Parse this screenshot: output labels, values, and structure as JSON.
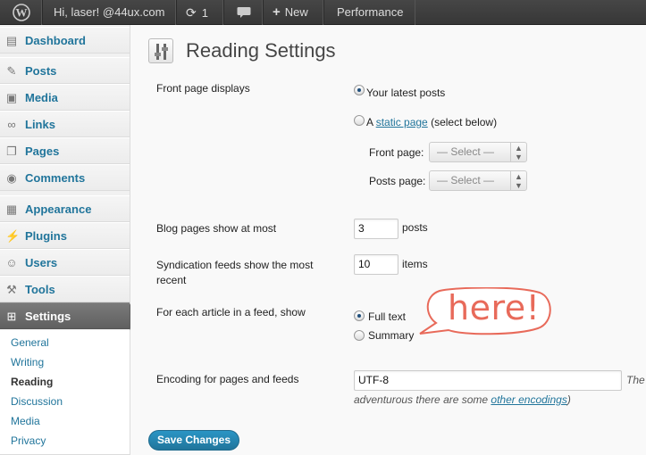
{
  "adminbar": {
    "wp_logo": "wordpress-icon",
    "howdy": "Hi, laser! @44ux.com",
    "updates_count": "1",
    "new_label": "New",
    "performance_label": "Performance"
  },
  "sidebar": {
    "items": [
      {
        "label": "Dashboard",
        "icon": "dashboard-icon"
      },
      {
        "label": "Posts",
        "icon": "pin-icon"
      },
      {
        "label": "Media",
        "icon": "media-icon"
      },
      {
        "label": "Links",
        "icon": "link-icon"
      },
      {
        "label": "Pages",
        "icon": "pages-icon"
      },
      {
        "label": "Comments",
        "icon": "comment-icon"
      },
      {
        "label": "Appearance",
        "icon": "appearance-icon"
      },
      {
        "label": "Plugins",
        "icon": "plugin-icon"
      },
      {
        "label": "Users",
        "icon": "users-icon"
      },
      {
        "label": "Tools",
        "icon": "tools-icon"
      },
      {
        "label": "Settings",
        "icon": "settings-icon"
      }
    ],
    "submenu": [
      "General",
      "Writing",
      "Reading",
      "Discussion",
      "Media",
      "Privacy"
    ]
  },
  "main": {
    "title": "Reading Settings",
    "front_page_displays_label": "Front page displays",
    "option_latest": "Your latest posts",
    "option_static_prefix": "A ",
    "option_static_link": "static page",
    "option_static_suffix": " (select below)",
    "front_page_label": "Front page:",
    "posts_page_label": "Posts page:",
    "select_placeholder": "— Select —",
    "blog_pages_label": "Blog pages show at most",
    "blog_pages_value": "3",
    "blog_pages_unit": "posts",
    "syndication_label": "Syndication feeds show the most recent",
    "syndication_value": "10",
    "syndication_unit": "items",
    "feed_article_label": "For each article in a feed, show",
    "feed_full_text": "Full text",
    "feed_summary": "Summary",
    "encoding_label": "Encoding for pages and feeds",
    "encoding_value": "UTF-8",
    "encoding_desc_1": "The",
    "encoding_desc_2a": "adventurous there are some ",
    "encoding_desc_link": "other encodings",
    "encoding_desc_2b": ")",
    "save_button": "Save Changes",
    "callout": "here!"
  },
  "colors": {
    "accent": "#21759b",
    "callout": "#e86a5a",
    "adminbar": "#464646"
  }
}
